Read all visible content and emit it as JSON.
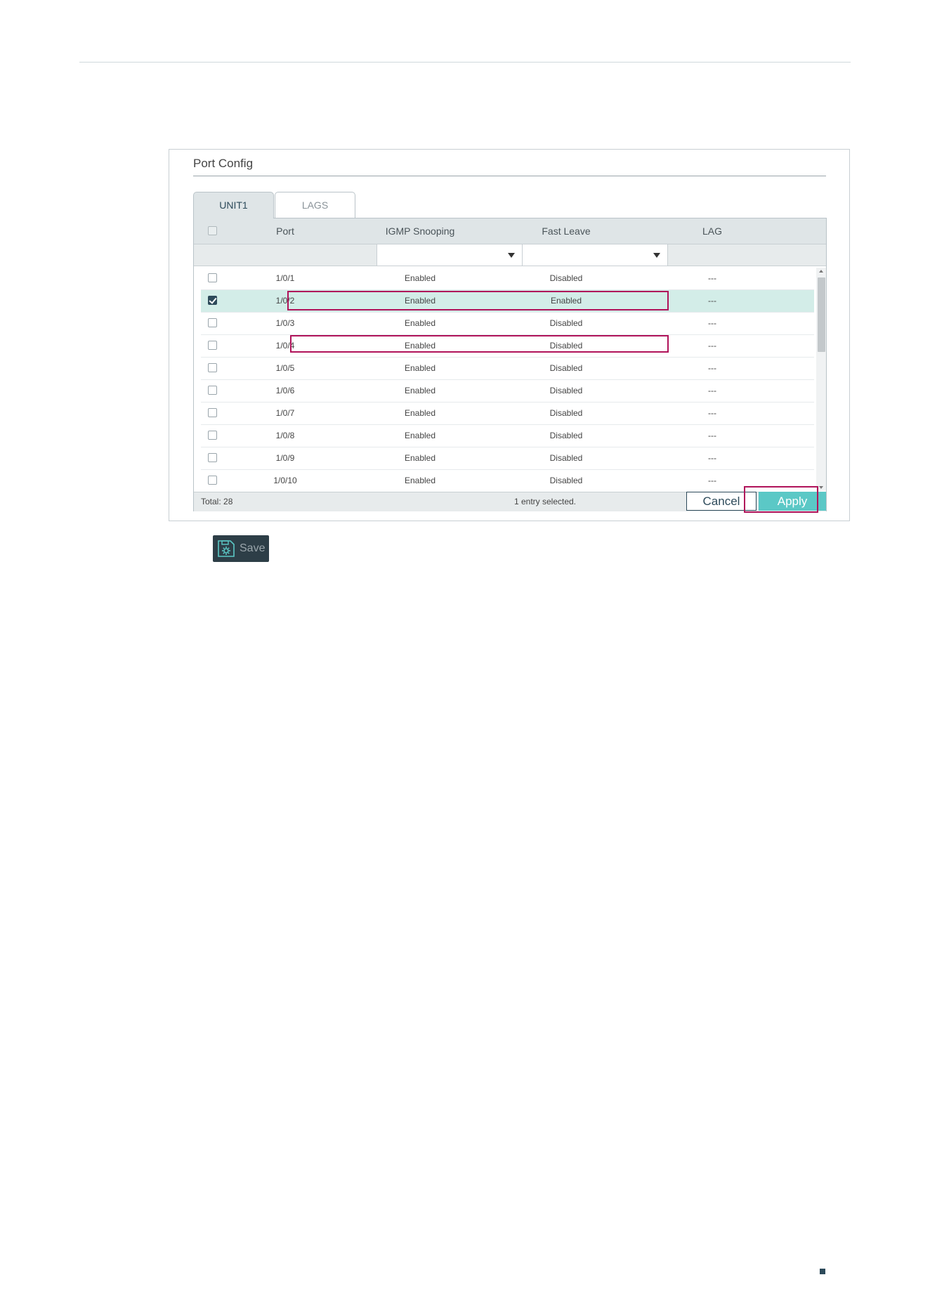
{
  "panel": {
    "title": "Port Config"
  },
  "tabs": [
    {
      "label": "UNIT1",
      "active": true
    },
    {
      "label": "LAGS",
      "active": false
    }
  ],
  "table": {
    "columns": [
      "Port",
      "IGMP Snooping",
      "Fast Leave",
      "LAG"
    ],
    "rows": [
      {
        "port": "1/0/1",
        "igmp": "Enabled",
        "fast_leave": "Disabled",
        "lag": "---",
        "checked": false
      },
      {
        "port": "1/0/2",
        "igmp": "Enabled",
        "fast_leave": "Enabled",
        "lag": "---",
        "checked": true
      },
      {
        "port": "1/0/3",
        "igmp": "Enabled",
        "fast_leave": "Disabled",
        "lag": "---",
        "checked": false
      },
      {
        "port": "1/0/4",
        "igmp": "Enabled",
        "fast_leave": "Disabled",
        "lag": "---",
        "checked": false
      },
      {
        "port": "1/0/5",
        "igmp": "Enabled",
        "fast_leave": "Disabled",
        "lag": "---",
        "checked": false
      },
      {
        "port": "1/0/6",
        "igmp": "Enabled",
        "fast_leave": "Disabled",
        "lag": "---",
        "checked": false
      },
      {
        "port": "1/0/7",
        "igmp": "Enabled",
        "fast_leave": "Disabled",
        "lag": "---",
        "checked": false
      },
      {
        "port": "1/0/8",
        "igmp": "Enabled",
        "fast_leave": "Disabled",
        "lag": "---",
        "checked": false
      },
      {
        "port": "1/0/9",
        "igmp": "Enabled",
        "fast_leave": "Disabled",
        "lag": "---",
        "checked": false
      },
      {
        "port": "1/0/10",
        "igmp": "Enabled",
        "fast_leave": "Disabled",
        "lag": "---",
        "checked": false
      }
    ]
  },
  "footer": {
    "total": "Total: 28",
    "selected": "1 entry selected.",
    "cancel_label": "Cancel",
    "apply_label": "Apply"
  },
  "save": {
    "label": "Save",
    "icon": "save-gear-icon"
  },
  "colors": {
    "accent": "#5bc8c6",
    "highlight": "#b0135a",
    "dark": "#2d4a5a",
    "selected_row": "#d3ede8"
  }
}
